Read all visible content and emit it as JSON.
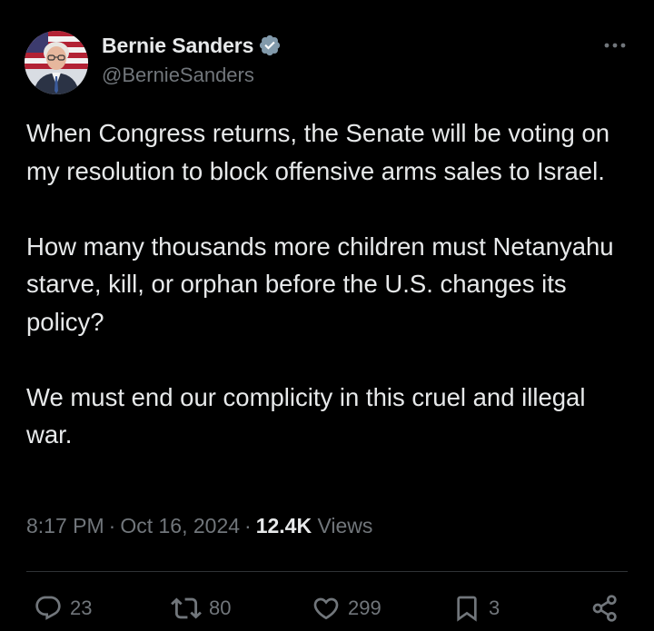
{
  "author": {
    "display_name": "Bernie Sanders",
    "handle": "@BernieSanders",
    "verified": true,
    "avatar_icon": "profile-photo"
  },
  "tweet": {
    "paragraphs": [
      "When Congress returns, the Senate will be voting on my resolution to block offensive arms sales to Israel.",
      "How many thousands more children must Netanyahu starve, kill, or orphan before the U.S. changes its policy?",
      "We must end our complicity in this cruel and illegal war."
    ]
  },
  "meta": {
    "time": "8:17 PM",
    "dot1": "·",
    "date": "Oct 16, 2024",
    "dot2": "·",
    "views_count": "12.4K",
    "views_label": "Views"
  },
  "actions": {
    "replies": "23",
    "reposts": "80",
    "likes": "299",
    "bookmarks": "3"
  },
  "colors": {
    "background": "#000000",
    "text_primary": "#e7e9ea",
    "text_secondary": "#71767b",
    "verified_badge": "#829aab",
    "divider": "#2f3336"
  }
}
